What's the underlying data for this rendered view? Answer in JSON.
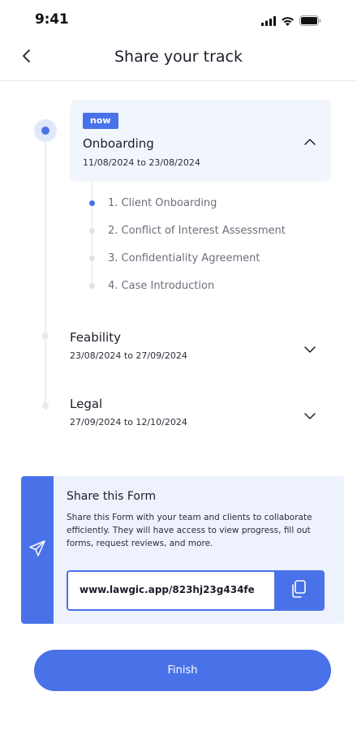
{
  "status_bar": {
    "time": "9:41",
    "icons": [
      "signal-icon",
      "wifi-icon",
      "battery-icon"
    ]
  },
  "header": {
    "title": "Share your track",
    "back_icon": "chevron-left-icon"
  },
  "timeline": {
    "stages": [
      {
        "badge": "now",
        "title": "Onboarding",
        "dates": "11/08/2024 to 23/08/2024",
        "expanded": true,
        "substeps": [
          {
            "label": "1. Client Onboarding",
            "current": true
          },
          {
            "label": "2. Conflict of Interest Assessment",
            "current": false
          },
          {
            "label": "3. Confidentiality Agreement",
            "current": false
          },
          {
            "label": "4. Case Introduction",
            "current": false
          }
        ]
      },
      {
        "title": "Feability",
        "dates": "23/08/2024 to 27/09/2024",
        "expanded": false
      },
      {
        "title": "Legal",
        "dates": "27/09/2024 to 12/10/2024",
        "expanded": false
      }
    ]
  },
  "share": {
    "title": "Share this Form",
    "description": "Share this Form with your team and clients to collaborate efficiently. They will have access to view progress, fill out forms, request reviews, and more.",
    "link": "www.lawgic.app/823hj23g434fe",
    "icon": "send-icon",
    "copy_icon": "copy-icon"
  },
  "actions": {
    "finish_label": "Finish"
  },
  "colors": {
    "accent": "#4a72e8",
    "card_bg": "#f1f6fd",
    "share_bg": "#eef2fc"
  }
}
